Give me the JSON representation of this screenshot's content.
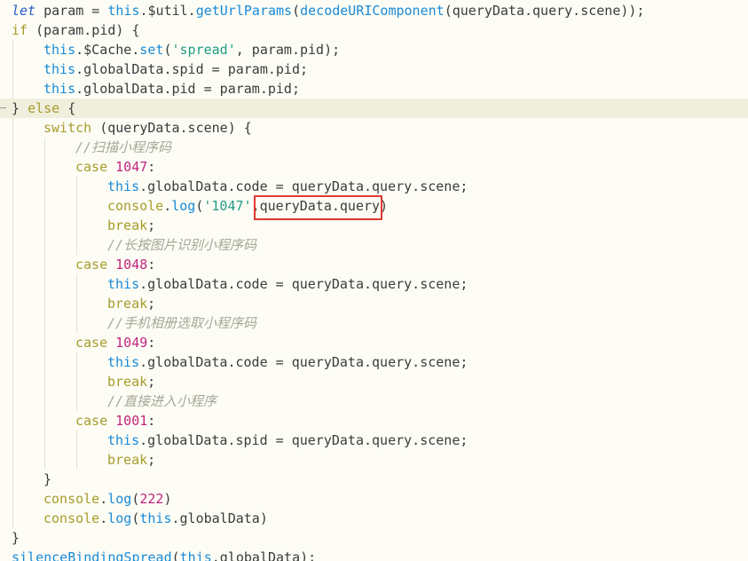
{
  "editor": {
    "lines": [
      {
        "indent": 0,
        "tokens": [
          {
            "t": "let",
            "c": "kw-i"
          },
          {
            "t": " param = ",
            "c": "plain"
          },
          {
            "t": "this",
            "c": "this"
          },
          {
            "t": ".$util.",
            "c": "plain"
          },
          {
            "t": "getUrlParams",
            "c": "fn"
          },
          {
            "t": "(",
            "c": "plain"
          },
          {
            "t": "decodeURIComponent",
            "c": "fn"
          },
          {
            "t": "(queryData.query.scene));",
            "c": "plain"
          }
        ]
      },
      {
        "indent": 0,
        "tokens": [
          {
            "t": "if",
            "c": "kw"
          },
          {
            "t": " (param.pid) {",
            "c": "plain"
          }
        ]
      },
      {
        "indent": 1,
        "tokens": [
          {
            "t": "this",
            "c": "this"
          },
          {
            "t": ".$Cache.",
            "c": "plain"
          },
          {
            "t": "set",
            "c": "fn"
          },
          {
            "t": "(",
            "c": "plain"
          },
          {
            "t": "'spread'",
            "c": "str"
          },
          {
            "t": ", param.pid);",
            "c": "plain"
          }
        ]
      },
      {
        "indent": 1,
        "tokens": [
          {
            "t": "this",
            "c": "this"
          },
          {
            "t": ".globalData.spid = param.pid;",
            "c": "plain"
          }
        ]
      },
      {
        "indent": 1,
        "tokens": [
          {
            "t": "this",
            "c": "this"
          },
          {
            "t": ".globalData.pid = param.pid;",
            "c": "plain"
          }
        ]
      },
      {
        "indent": 0,
        "current": true,
        "tokens": [
          {
            "t": "} ",
            "c": "plain"
          },
          {
            "t": "else",
            "c": "kw"
          },
          {
            "t": " {",
            "c": "plain"
          }
        ]
      },
      {
        "indent": 1,
        "tokens": [
          {
            "t": "switch",
            "c": "kw"
          },
          {
            "t": " (queryData.scene) {",
            "c": "plain"
          }
        ]
      },
      {
        "indent": 2,
        "tokens": [
          {
            "t": "//扫描小程序码",
            "c": "cm"
          }
        ]
      },
      {
        "indent": 2,
        "tokens": [
          {
            "t": "case",
            "c": "kw"
          },
          {
            "t": " ",
            "c": "plain"
          },
          {
            "t": "1047",
            "c": "num"
          },
          {
            "t": ":",
            "c": "plain"
          }
        ]
      },
      {
        "indent": 3,
        "tokens": [
          {
            "t": "this",
            "c": "this"
          },
          {
            "t": ".globalData.code = queryData.query.scene;",
            "c": "plain"
          }
        ]
      },
      {
        "indent": 3,
        "tokens": [
          {
            "t": "console",
            "c": "kw"
          },
          {
            "t": ".",
            "c": "plain"
          },
          {
            "t": "log",
            "c": "fn"
          },
          {
            "t": "(",
            "c": "plain"
          },
          {
            "t": "'1047'",
            "c": "str"
          },
          {
            "t": ",queryData.query)",
            "c": "plain"
          }
        ]
      },
      {
        "indent": 3,
        "tokens": [
          {
            "t": "break",
            "c": "kw"
          },
          {
            "t": ";",
            "c": "plain"
          }
        ]
      },
      {
        "indent": 3,
        "tokens": [
          {
            "t": "//长按图片识别小程序码",
            "c": "cm"
          }
        ]
      },
      {
        "indent": 2,
        "tokens": [
          {
            "t": "case",
            "c": "kw"
          },
          {
            "t": " ",
            "c": "plain"
          },
          {
            "t": "1048",
            "c": "num"
          },
          {
            "t": ":",
            "c": "plain"
          }
        ]
      },
      {
        "indent": 3,
        "tokens": [
          {
            "t": "this",
            "c": "this"
          },
          {
            "t": ".globalData.code = queryData.query.scene;",
            "c": "plain"
          }
        ]
      },
      {
        "indent": 3,
        "tokens": [
          {
            "t": "break",
            "c": "kw"
          },
          {
            "t": ";",
            "c": "plain"
          }
        ]
      },
      {
        "indent": 3,
        "tokens": [
          {
            "t": "//手机相册选取小程序码",
            "c": "cm"
          }
        ]
      },
      {
        "indent": 2,
        "tokens": [
          {
            "t": "case",
            "c": "kw"
          },
          {
            "t": " ",
            "c": "plain"
          },
          {
            "t": "1049",
            "c": "num"
          },
          {
            "t": ":",
            "c": "plain"
          }
        ]
      },
      {
        "indent": 3,
        "tokens": [
          {
            "t": "this",
            "c": "this"
          },
          {
            "t": ".globalData.code = queryData.query.scene;",
            "c": "plain"
          }
        ]
      },
      {
        "indent": 3,
        "tokens": [
          {
            "t": "break",
            "c": "kw"
          },
          {
            "t": ";",
            "c": "plain"
          }
        ]
      },
      {
        "indent": 3,
        "tokens": [
          {
            "t": "//直接进入小程序",
            "c": "cm"
          }
        ]
      },
      {
        "indent": 2,
        "tokens": [
          {
            "t": "case",
            "c": "kw"
          },
          {
            "t": " ",
            "c": "plain"
          },
          {
            "t": "1001",
            "c": "num"
          },
          {
            "t": ":",
            "c": "plain"
          }
        ]
      },
      {
        "indent": 3,
        "tokens": [
          {
            "t": "this",
            "c": "this"
          },
          {
            "t": ".globalData.spid = queryData.query.scene;",
            "c": "plain"
          }
        ]
      },
      {
        "indent": 3,
        "tokens": [
          {
            "t": "break",
            "c": "kw"
          },
          {
            "t": ";",
            "c": "plain"
          }
        ]
      },
      {
        "indent": 1,
        "tokens": [
          {
            "t": "}",
            "c": "plain"
          }
        ]
      },
      {
        "indent": 1,
        "tokens": [
          {
            "t": "console",
            "c": "kw"
          },
          {
            "t": ".",
            "c": "plain"
          },
          {
            "t": "log",
            "c": "fn"
          },
          {
            "t": "(",
            "c": "plain"
          },
          {
            "t": "222",
            "c": "num"
          },
          {
            "t": ")",
            "c": "plain"
          }
        ]
      },
      {
        "indent": 1,
        "tokens": [
          {
            "t": "console",
            "c": "kw"
          },
          {
            "t": ".",
            "c": "plain"
          },
          {
            "t": "log",
            "c": "fn"
          },
          {
            "t": "(",
            "c": "plain"
          },
          {
            "t": "this",
            "c": "this"
          },
          {
            "t": ".globalData)",
            "c": "plain"
          }
        ]
      },
      {
        "indent": 0,
        "tokens": [
          {
            "t": "}",
            "c": "plain"
          }
        ]
      },
      {
        "indent": 0,
        "tokens": [
          {
            "t": "silenceBindingSpread",
            "c": "fn"
          },
          {
            "t": "(",
            "c": "plain"
          },
          {
            "t": "this",
            "c": "this"
          },
          {
            "t": ".globalData);",
            "c": "plain"
          }
        ]
      }
    ]
  },
  "colors": {
    "background": "#FDFDF6",
    "current_line": "#F0EFDD",
    "highlight_box": "#E03A2F"
  }
}
